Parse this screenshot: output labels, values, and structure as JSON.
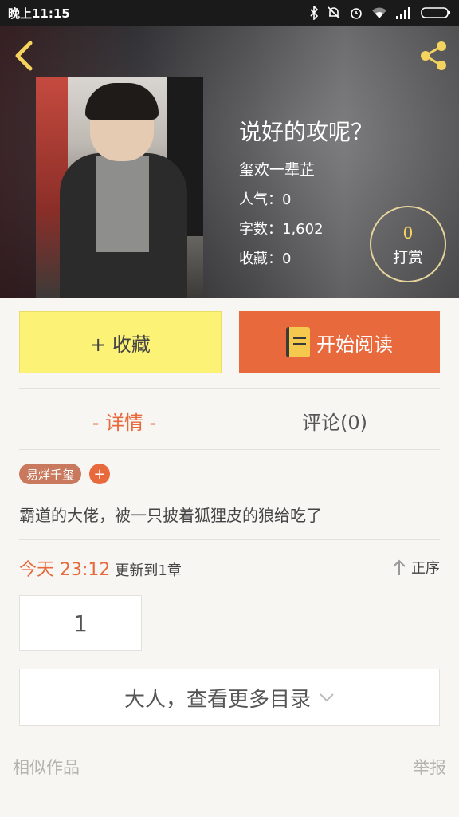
{
  "status_bar": {
    "time": "晚上11:15"
  },
  "book": {
    "title": "说好的攻呢？",
    "author": "玺欢一辈芷",
    "popularity": "人气：0",
    "word_count": "字数：1,602",
    "favorites": "收藏：0",
    "reward_count": "0",
    "reward_label": "打赏"
  },
  "actions": {
    "collect_label": "+ 收藏",
    "read_label": "开始阅读"
  },
  "tabs": [
    {
      "label": "- 详情 -",
      "active": true
    },
    {
      "label": "评论(0)",
      "active": false
    }
  ],
  "tags": [
    {
      "label": "易烊千玺"
    }
  ],
  "tag_add_label": "+",
  "description": "霸道的大佬，被一只披着狐狸皮的狼给吃了",
  "update": {
    "date": "今天 23:12",
    "text": "更新到1章"
  },
  "sort_label": "正序",
  "chapters": [
    {
      "number": "1"
    }
  ],
  "more_label": "大人，查看更多目录",
  "footer": {
    "similar": "相似作品",
    "report": "举报"
  },
  "colors": {
    "accent": "#e8693c",
    "collect_bg": "#fcf276",
    "tag_bg": "#c97a5e",
    "back_icon": "#f4d35e"
  }
}
